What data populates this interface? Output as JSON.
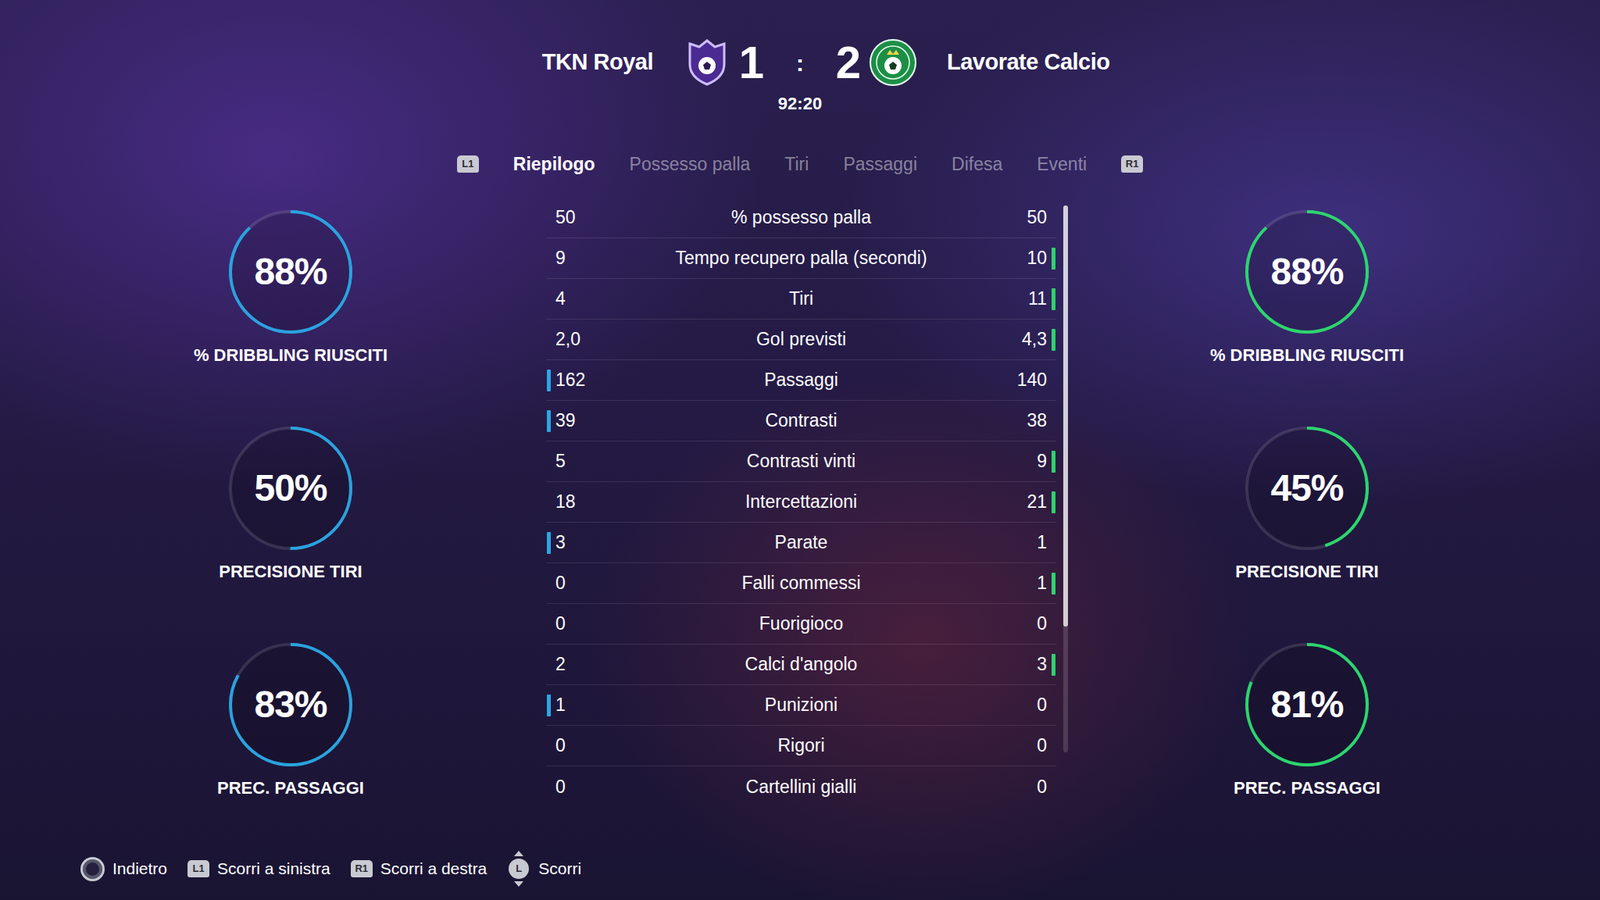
{
  "match": {
    "home": {
      "name": "TKN Royal",
      "score": "1"
    },
    "away": {
      "name": "Lavorate Calcio",
      "score": "2"
    },
    "separator": ":",
    "clock": "92:20"
  },
  "tabs": {
    "prev_key": "L1",
    "next_key": "R1",
    "items": [
      {
        "label": "Riepilogo",
        "selected": true
      },
      {
        "label": "Possesso palla",
        "selected": false
      },
      {
        "label": "Tiri",
        "selected": false
      },
      {
        "label": "Passaggi",
        "selected": false
      },
      {
        "label": "Difesa",
        "selected": false
      },
      {
        "label": "Eventi",
        "selected": false
      }
    ]
  },
  "home_rings": {
    "color": "#29a3df",
    "items": [
      {
        "value": "88%",
        "label": "% DRIBBLING RIUSCITI",
        "level": 0.88
      },
      {
        "value": "50%",
        "label": "PRECISIONE TIRI",
        "level": 0.5
      },
      {
        "value": "83%",
        "label": "PREC. PASSAGGI",
        "level": 0.83
      }
    ]
  },
  "away_rings": {
    "color": "#2bd66e",
    "items": [
      {
        "value": "88%",
        "label": "% DRIBBLING RIUSCITI",
        "level": 0.88
      },
      {
        "value": "45%",
        "label": "PRECISIONE TIRI",
        "level": 0.45
      },
      {
        "value": "81%",
        "label": "PREC. PASSAGGI",
        "level": 0.81
      }
    ]
  },
  "table": {
    "rows": [
      {
        "home": "50",
        "label": "% possesso palla",
        "away": "50",
        "lead": "none"
      },
      {
        "home": "9",
        "label": "Tempo recupero palla (secondi)",
        "away": "10",
        "lead": "away"
      },
      {
        "home": "4",
        "label": "Tiri",
        "away": "11",
        "lead": "away"
      },
      {
        "home": "2,0",
        "label": "Gol previsti",
        "away": "4,3",
        "lead": "away"
      },
      {
        "home": "162",
        "label": "Passaggi",
        "away": "140",
        "lead": "home"
      },
      {
        "home": "39",
        "label": "Contrasti",
        "away": "38",
        "lead": "home"
      },
      {
        "home": "5",
        "label": "Contrasti vinti",
        "away": "9",
        "lead": "away"
      },
      {
        "home": "18",
        "label": "Intercettazioni",
        "away": "21",
        "lead": "away"
      },
      {
        "home": "3",
        "label": "Parate",
        "away": "1",
        "lead": "home"
      },
      {
        "home": "0",
        "label": "Falli commessi",
        "away": "1",
        "lead": "away"
      },
      {
        "home": "0",
        "label": "Fuorigioco",
        "away": "0",
        "lead": "none"
      },
      {
        "home": "2",
        "label": "Calci d'angolo",
        "away": "3",
        "lead": "away"
      },
      {
        "home": "1",
        "label": "Punizioni",
        "away": "0",
        "lead": "home"
      },
      {
        "home": "0",
        "label": "Rigori",
        "away": "0",
        "lead": "none"
      },
      {
        "home": "0",
        "label": "Cartellini gialli",
        "away": "0",
        "lead": "none"
      }
    ],
    "scroll": {
      "level": 0.77
    }
  },
  "footer": [
    {
      "kind": "circle",
      "label": "Indietro"
    },
    {
      "kind": "shoulder",
      "key": "L1",
      "label": "Scorri a sinistra"
    },
    {
      "kind": "shoulder",
      "key": "R1",
      "label": "Scorri a destra"
    },
    {
      "kind": "stick",
      "key": "L",
      "label": "Scorri"
    }
  ]
}
